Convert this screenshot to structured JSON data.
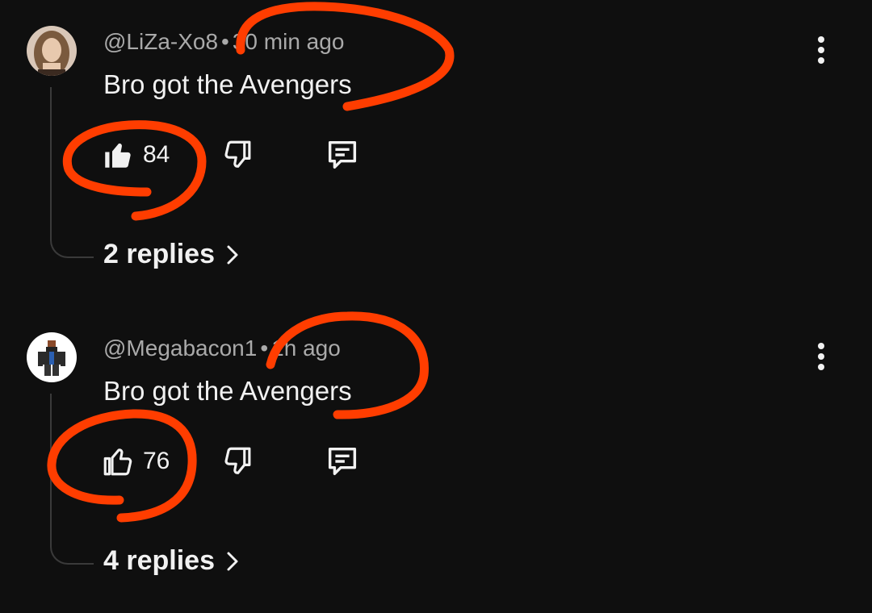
{
  "comments": [
    {
      "author": "@LiZa-Xo8",
      "time": "30 min ago",
      "text": "Bro got the Avengers",
      "likes": "84",
      "liked": true,
      "replies": "2 replies"
    },
    {
      "author": "@Megabacon1",
      "time": "1h ago",
      "text": "Bro got the Avengers",
      "likes": "76",
      "liked": false,
      "replies": "4 replies"
    }
  ],
  "icons": {
    "like": "thumbs-up-icon",
    "dislike": "thumbs-down-icon",
    "reply": "comment-icon",
    "menu": "more-vert-icon",
    "chevron": "chevron-right-icon"
  },
  "colors": {
    "background": "#0f0f0f",
    "text": "#f1f1f1",
    "meta": "#aaaaaa",
    "annotation": "#ff3d00"
  }
}
